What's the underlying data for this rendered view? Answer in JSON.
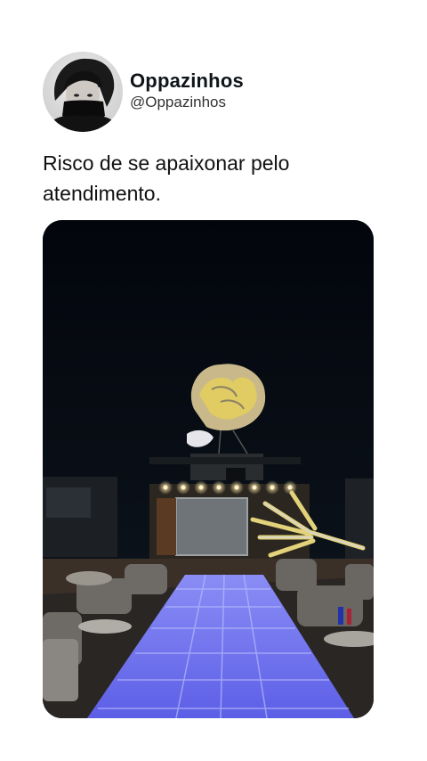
{
  "tweet": {
    "author_name": "Oppazinhos",
    "author_handle": "@Oppazinhos",
    "text": "Risco de se apaixonar pelo atendimento."
  },
  "media": {
    "type": "photo",
    "icon": "video-frame"
  },
  "colors": {
    "background": "#ffffff",
    "text": "#111111",
    "runway": "#6d6cf0",
    "sky": "#05070e"
  }
}
